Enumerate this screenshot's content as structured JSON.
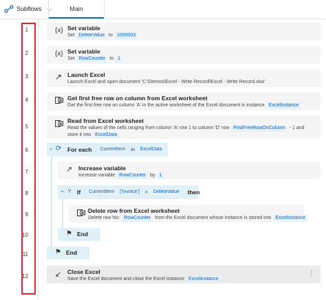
{
  "topbar": {
    "subflows_label": "Subflows",
    "tab_main": "Main"
  },
  "line_numbers": [
    "1",
    "2",
    "3",
    "4",
    "5",
    "6",
    "7",
    "8",
    "9",
    "10",
    "11",
    "12"
  ],
  "steps": {
    "s1": {
      "title": "Set variable",
      "pre": "Set",
      "var": "DeleteValue",
      "mid": "to",
      "val": "1000003"
    },
    "s2": {
      "title": "Set variable",
      "pre": "Set",
      "var": "RowCounter",
      "mid": "to",
      "val": "1"
    },
    "s3": {
      "title": "Launch Excel",
      "desc": "Launch Excel and open document 'C:\\Demos\\Excel - Write Record\\Excel - Write Record.xlsx'"
    },
    "s4": {
      "title": "Get first free row on column from Excel worksheet",
      "desc": "Get the first free row on column 'A' in the active worksheet of the Excel document in instance",
      "inst": "ExcelInstance"
    },
    "s5": {
      "title": "Read from Excel worksheet",
      "desc1": "Read the values of the cells ranging from column 'A' row 1 to column 'D' row",
      "tok1": "FirstFreeRowOnColumn",
      "tail": "- 1 and",
      "desc2": "store it into",
      "tok2": "ExcelData"
    },
    "s6": {
      "kw": "For each",
      "item": "CurrentItem",
      "in": "in",
      "coll": "ExcelData"
    },
    "s7": {
      "title": "Increase variable",
      "pre": "Increase variable",
      "var": "RowCounter",
      "mid": "by",
      "val": "1"
    },
    "s8": {
      "kw": "If",
      "item": "CurrentItem",
      "idx": "['Invoice']",
      "op": "=",
      "val": "DeleteValue",
      "then": "then"
    },
    "s9": {
      "title": "Delete row from Excel worksheet",
      "pre": "Delete row No:",
      "var": "RowCounter",
      "mid": "from the Excel document whose instance is stored into",
      "inst": "ExcelInstance"
    },
    "s10": {
      "kw": "End"
    },
    "s11": {
      "kw": "End"
    },
    "s12": {
      "title": "Close Excel",
      "pre": "Save the Excel document and close the Excel instance",
      "inst": "ExcelInstance"
    }
  }
}
